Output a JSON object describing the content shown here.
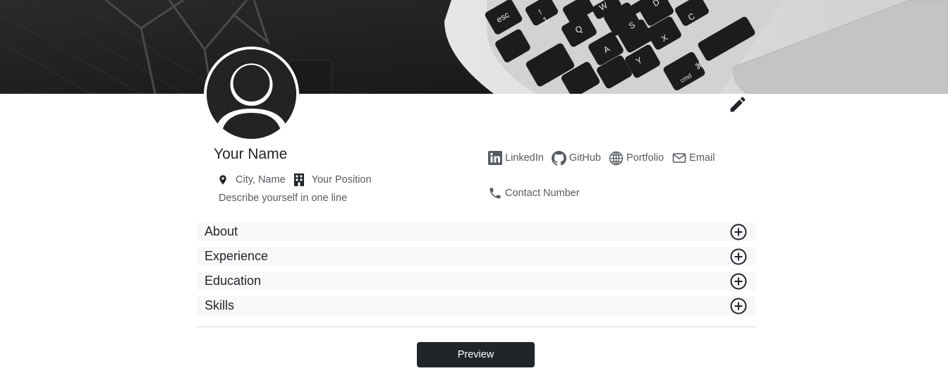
{
  "profile": {
    "name": "Your Name",
    "location": "City, Name",
    "position": "Your Position",
    "tagline": "Describe yourself in one line"
  },
  "links": [
    {
      "label": "LinkedIn",
      "icon": "linkedin-icon"
    },
    {
      "label": "GitHub",
      "icon": "github-icon"
    },
    {
      "label": "Portfolio",
      "icon": "globe-icon"
    },
    {
      "label": "Email",
      "icon": "envelope-icon"
    }
  ],
  "contact": {
    "label": "Contact Number",
    "icon": "phone-icon"
  },
  "sections": [
    {
      "label": "About"
    },
    {
      "label": "Experience"
    },
    {
      "label": "Education"
    },
    {
      "label": "Skills"
    }
  ],
  "keyboard_keys": [
    "esc",
    "!",
    "1",
    "Q",
    "W",
    "D",
    "A",
    "S",
    "X",
    "C",
    "Y",
    "cmd",
    "⌘"
  ],
  "actions": {
    "preview_label": "Preview"
  },
  "colors": {
    "primary_dark": "#212529",
    "section_bg": "#f7f8f9",
    "muted_text": "#555b61"
  }
}
